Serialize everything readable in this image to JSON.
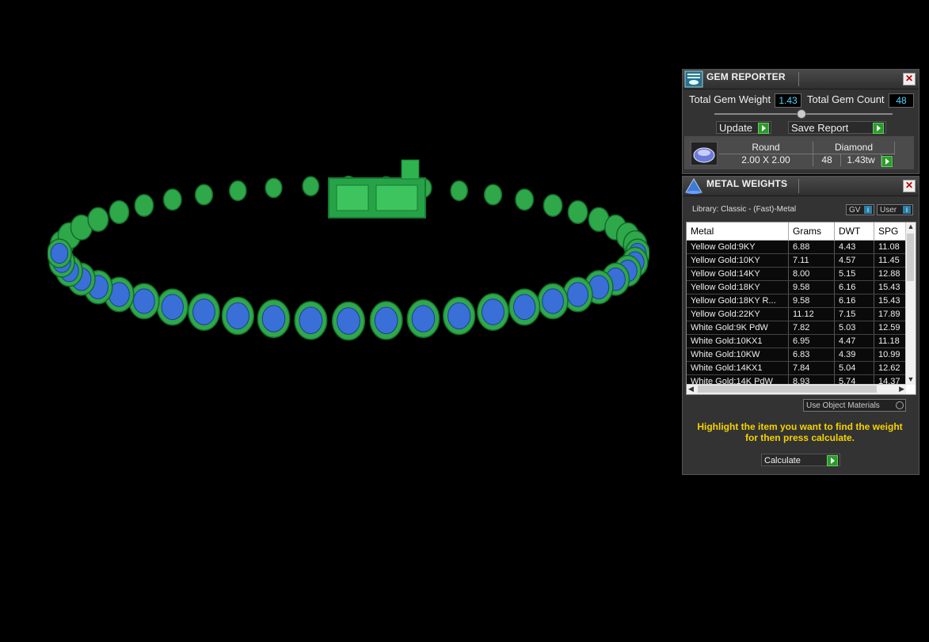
{
  "gem_reporter": {
    "title": "GEM REPORTER",
    "total_gem_weight_label": "Total Gem Weight",
    "total_gem_weight_value": "1.43",
    "total_gem_count_label": "Total Gem Count",
    "total_gem_count_value": "48",
    "update_label": "Update",
    "save_report_label": "Save Report",
    "gem": {
      "shape": "Round",
      "material": "Diamond",
      "size": "2.00 X 2.00",
      "count": "48",
      "weight": "1.43tw"
    }
  },
  "metal_weights": {
    "title": "METAL WEIGHTS",
    "library": "Library: Classic - (Fast)-Metal",
    "gv_label": "GV",
    "user_label": "User",
    "columns": [
      "Metal",
      "Grams",
      "DWT",
      "SPG"
    ],
    "rows": [
      [
        "Yellow Gold:9KY",
        "6.88",
        "4.43",
        "11.08"
      ],
      [
        "Yellow Gold:10KY",
        "7.11",
        "4.57",
        "11.45"
      ],
      [
        "Yellow Gold:14KY",
        "8.00",
        "5.15",
        "12.88"
      ],
      [
        "Yellow Gold:18KY",
        "9.58",
        "6.16",
        "15.43"
      ],
      [
        "Yellow Gold:18KY R...",
        "9.58",
        "6.16",
        "15.43"
      ],
      [
        "Yellow Gold:22KY",
        "11.12",
        "7.15",
        "17.89"
      ],
      [
        "White Gold:9K PdW",
        "7.82",
        "5.03",
        "12.59"
      ],
      [
        "White Gold:10KX1",
        "6.95",
        "4.47",
        "11.18"
      ],
      [
        "White Gold:10KW",
        "6.83",
        "4.39",
        "10.99"
      ],
      [
        "White Gold:14KX1",
        "7.84",
        "5.04",
        "12.62"
      ],
      [
        "White Gold:14K PdW",
        "8.93",
        "5.74",
        "14.37"
      ]
    ],
    "use_object_materials_label": "Use Object Materials",
    "hint": "Highlight the item you want to find the weight for then press calculate.",
    "calculate_label": "Calculate"
  },
  "colors": {
    "metal": "#2fa84a",
    "gem": "#3a6fd8",
    "accent_cyan": "#4fd6ff",
    "hint_yellow": "#f5d300"
  }
}
